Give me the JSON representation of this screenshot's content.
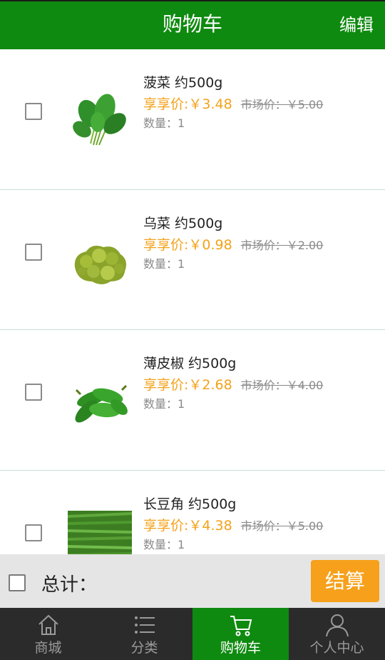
{
  "header": {
    "title": "购物车",
    "edit_label": "编辑"
  },
  "items": [
    {
      "name": "菠菜 约500g",
      "price_label": "享享价:",
      "price": "￥3.48",
      "market_price": "市场价：￥5.00",
      "quantity": "数量：1",
      "image_icon": "spinach-image"
    },
    {
      "name": "乌菜 约500g",
      "price_label": "享享价:",
      "price": "￥0.98",
      "market_price": "市场价：￥2.00",
      "quantity": "数量：1",
      "image_icon": "broccoli-image"
    },
    {
      "name": "薄皮椒 约500g",
      "price_label": "享享价:",
      "price": "￥2.68",
      "market_price": "市场价：￥4.00",
      "quantity": "数量：1",
      "image_icon": "green-pepper-image"
    },
    {
      "name": "长豆角 约500g",
      "price_label": "享享价:",
      "price": "￥4.38",
      "market_price": "市场价：￥5.00",
      "quantity": "数量：1",
      "image_icon": "long-bean-image"
    }
  ],
  "summary": {
    "total_label": "总计：",
    "checkout_label": "结算"
  },
  "tabs": [
    {
      "label": "商城",
      "icon": "home-icon"
    },
    {
      "label": "分类",
      "icon": "list-icon"
    },
    {
      "label": "购物车",
      "icon": "cart-icon",
      "active": true
    },
    {
      "label": "个人中心",
      "icon": "user-icon"
    }
  ],
  "colors": {
    "brand": "#0f8a10",
    "price": "#f3a21a",
    "checkout": "#f7a01b"
  }
}
